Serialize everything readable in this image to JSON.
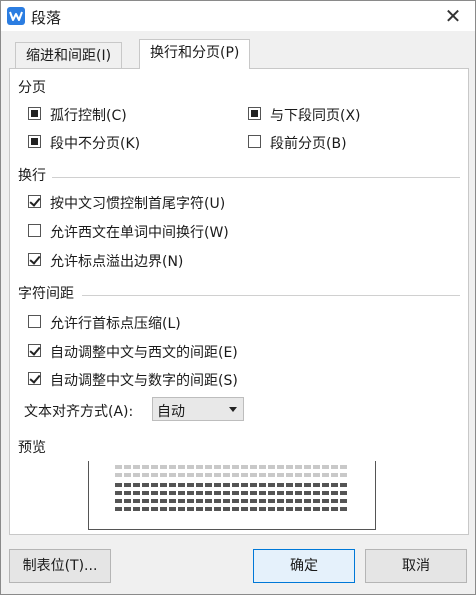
{
  "window": {
    "title": "段落",
    "close_glyph": "✕"
  },
  "tabs": [
    {
      "label": "缩进和间距(I)",
      "active": false
    },
    {
      "label": "换行和分页(P)",
      "active": true
    }
  ],
  "pagination": {
    "heading": "分页",
    "options": [
      {
        "label": "孤行控制(C)",
        "state": "indeterminate"
      },
      {
        "label": "与下段同页(X)",
        "state": "indeterminate"
      },
      {
        "label": "段中不分页(K)",
        "state": "indeterminate"
      },
      {
        "label": "段前分页(B)",
        "state": "unchecked"
      }
    ]
  },
  "line_break": {
    "heading": "换行",
    "options": [
      {
        "label": "按中文习惯控制首尾字符(U)",
        "state": "checked"
      },
      {
        "label": "允许西文在单词中间换行(W)",
        "state": "unchecked"
      },
      {
        "label": "允许标点溢出边界(N)",
        "state": "checked"
      }
    ]
  },
  "char_spacing": {
    "heading": "字符间距",
    "options": [
      {
        "label": "允许行首标点压缩(L)",
        "state": "unchecked"
      },
      {
        "label": "自动调整中文与西文的间距(E)",
        "state": "checked"
      },
      {
        "label": "自动调整中文与数字的间距(S)",
        "state": "checked"
      }
    ]
  },
  "text_alignment": {
    "label": "文本对齐方式(A):",
    "value": "自动"
  },
  "preview": {
    "heading": "预览"
  },
  "buttons": {
    "tabs": "制表位(T)...",
    "ok": "确定",
    "cancel": "取消"
  },
  "colors": {
    "accent": "#2b7de1",
    "ok_border": "#0078d7"
  }
}
